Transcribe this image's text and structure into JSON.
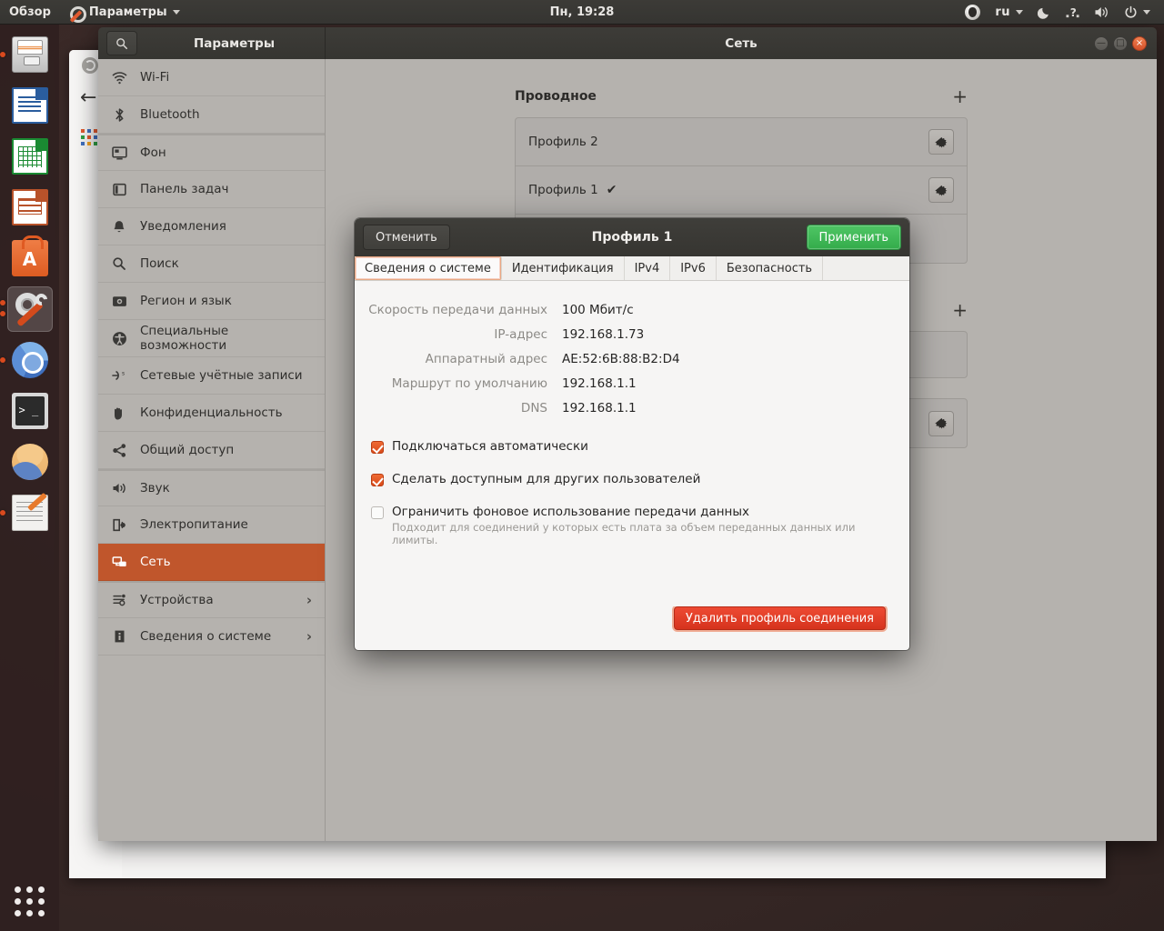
{
  "topbar": {
    "overview": "Обзор",
    "app_menu": "Параметры",
    "clock": "Пн, 19:28",
    "keyboard_layout": "ru",
    "icons": [
      "ubuntu-circle-icon",
      "caret-down-icon",
      "night-mode-icon",
      "help-icon",
      "volume-icon",
      "power-icon"
    ]
  },
  "launcher": {
    "items": [
      {
        "name": "files",
        "running": true
      },
      {
        "name": "libreoffice-writer",
        "running": false
      },
      {
        "name": "libreoffice-calc",
        "running": false
      },
      {
        "name": "libreoffice-impress",
        "running": false
      },
      {
        "name": "ubuntu-software",
        "running": false
      },
      {
        "name": "settings",
        "running": true,
        "active": true
      },
      {
        "name": "chromium",
        "running": true
      },
      {
        "name": "terminal",
        "running": false
      },
      {
        "name": "image-viewer",
        "running": false
      },
      {
        "name": "text-editor",
        "running": true
      }
    ],
    "app_grid": "show-applications"
  },
  "window": {
    "sidebar_title": "Параметры",
    "title": "Сеть",
    "search_placeholder": "Поиск",
    "buttons": {
      "minimize": "—",
      "maximize": "□",
      "close": "×"
    }
  },
  "sidebar": {
    "items": [
      {
        "label": "Wi-Fi",
        "icon": "wifi-icon",
        "group": 0
      },
      {
        "label": "Bluetooth",
        "icon": "bluetooth-icon",
        "group": 0
      },
      {
        "label": "Фон",
        "icon": "background-icon",
        "group": 1
      },
      {
        "label": "Панель задач",
        "icon": "dock-icon",
        "group": 1
      },
      {
        "label": "Уведомления",
        "icon": "bell-icon",
        "group": 1
      },
      {
        "label": "Поиск",
        "icon": "search-icon",
        "group": 1
      },
      {
        "label": "Регион и язык",
        "icon": "region-icon",
        "group": 1
      },
      {
        "label": "Специальные возможности",
        "icon": "accessibility-icon",
        "group": 1
      },
      {
        "label": "Сетевые учётные записи",
        "icon": "online-accounts-icon",
        "group": 1
      },
      {
        "label": "Конфиденциальность",
        "icon": "privacy-icon",
        "group": 1
      },
      {
        "label": "Общий доступ",
        "icon": "sharing-icon",
        "group": 1
      },
      {
        "label": "Звук",
        "icon": "sound-icon",
        "group": 2
      },
      {
        "label": "Электропитание",
        "icon": "power-icon",
        "group": 2
      },
      {
        "label": "Сеть",
        "icon": "network-icon",
        "group": 2,
        "active": true
      },
      {
        "label": "Устройства",
        "icon": "devices-icon",
        "group": 3,
        "chevron": "›"
      },
      {
        "label": "Сведения о системе",
        "icon": "info-icon",
        "group": 3,
        "chevron": "›"
      }
    ]
  },
  "network_panel": {
    "sections": [
      {
        "title": "Проводное",
        "add_label": "+",
        "rows": [
          {
            "label": "Профиль 2",
            "connected": false,
            "gear": "gear-icon"
          },
          {
            "label": "Профиль 1",
            "connected": true,
            "check": "✔",
            "gear": "gear-icon"
          }
        ]
      },
      {
        "title": "",
        "add_label": "+",
        "rows": [
          {
            "label": "",
            "gear": "gear-icon"
          }
        ]
      }
    ]
  },
  "dialog": {
    "cancel_label": "Отменить",
    "title": "Профиль 1",
    "apply_label": "Применить",
    "tabs": [
      {
        "label": "Сведения о системе",
        "active": true
      },
      {
        "label": "Идентификация",
        "active": false
      },
      {
        "label": "IPv4",
        "active": false
      },
      {
        "label": "IPv6",
        "active": false
      },
      {
        "label": "Безопасность",
        "active": false
      }
    ],
    "details": [
      {
        "label": "Скорость передачи данных",
        "value": "100 Мбит/с"
      },
      {
        "label": "IP-адрес",
        "value": "192.168.1.73"
      },
      {
        "label": "Аппаратный адрес",
        "value": "AE:52:6B:88:B2:D4"
      },
      {
        "label": "Маршрут по умолчанию",
        "value": "192.168.1.1"
      },
      {
        "label": "DNS",
        "value": "192.168.1.1"
      }
    ],
    "checkboxes": [
      {
        "label": "Подключаться автоматически",
        "checked": true,
        "hint": ""
      },
      {
        "label": "Сделать доступным для других пользователей",
        "checked": true,
        "hint": ""
      },
      {
        "label": "Ограничить фоновое использование передачи данных",
        "checked": false,
        "hint": "Подходит для соединений у которых есть плата за объем переданных данных или лимиты."
      }
    ],
    "delete_label": "Удалить профиль соединения"
  },
  "colors": {
    "accent": "#E95420",
    "selection": "#C0562C",
    "apply_green": "#33AC4B",
    "delete_red": "#D6331D",
    "panel_grey": "#B5B2AE",
    "dialog_bg": "#F6F5F4",
    "headerbar": "#363531"
  }
}
